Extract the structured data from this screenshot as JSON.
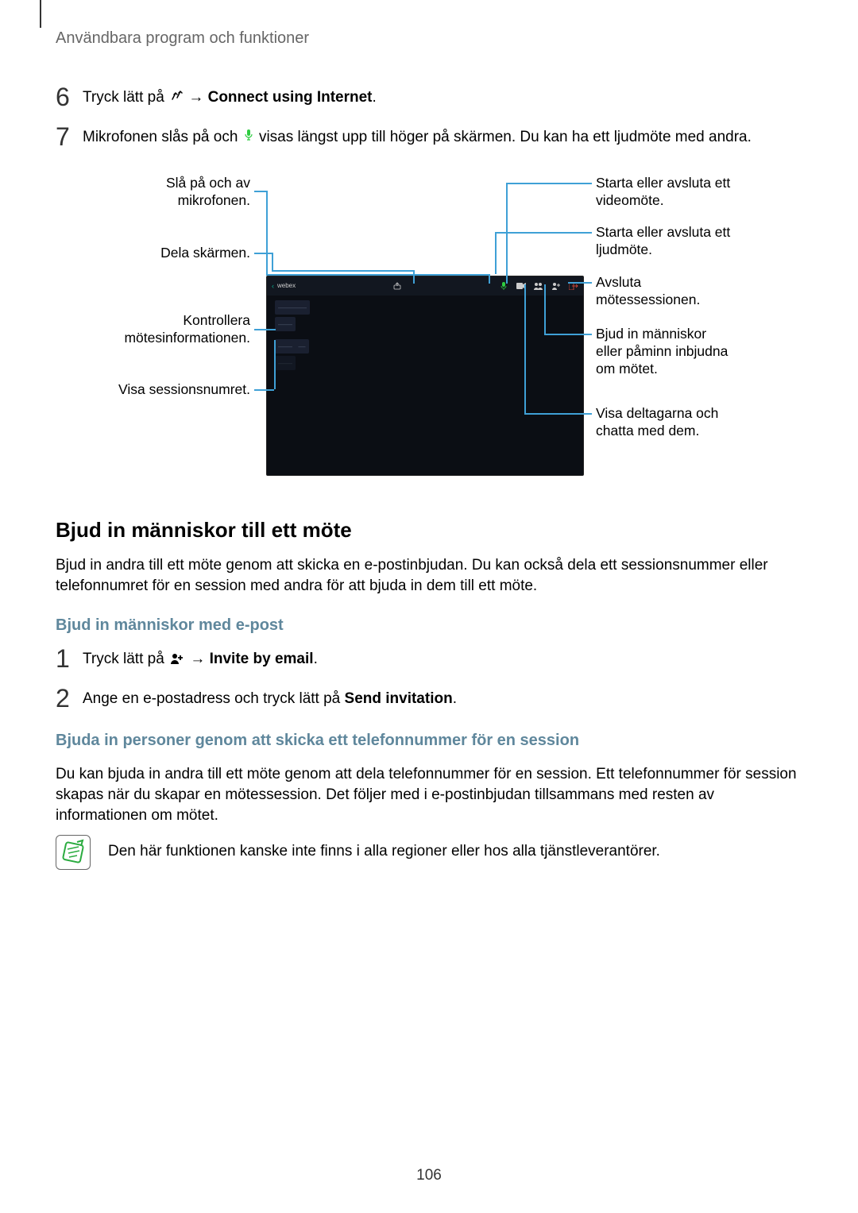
{
  "header": {
    "title": "Användbara program och funktioner"
  },
  "step6": {
    "num": "6",
    "pre": "Tryck lätt på ",
    "arrow": " → ",
    "bold": "Connect using Internet",
    "period": "."
  },
  "step7": {
    "num": "7",
    "pre": "Mikrofonen slås på och ",
    "post": " visas längst upp till höger på skärmen. Du kan ha ett ljudmöte med andra."
  },
  "callouts": {
    "left": [
      "Slå på och av mikrofonen.",
      "Dela skärmen.",
      "Kontrollera mötesinformationen.",
      "Visa sessionsnumret."
    ],
    "right": [
      "Starta eller avsluta ett videomöte.",
      "Starta eller avsluta ett ljudmöte.",
      "Avsluta mötessessionen.",
      "Bjud in människor eller påminn inbjudna om mötet.",
      "Visa deltagarna och chatta med dem."
    ]
  },
  "invite": {
    "heading": "Bjud in människor till ett möte",
    "body": "Bjud in andra till ett möte genom att skicka en e-postinbjudan. Du kan också dela ett sessionsnummer eller telefonnumret för en session med andra för att bjuda in dem till ett möte.",
    "email_heading": "Bjud in människor med e-post",
    "step1": {
      "num": "1",
      "pre": "Tryck lätt på ",
      "arrow": " → ",
      "bold": "Invite by email",
      "period": "."
    },
    "step2": {
      "num": "2",
      "pre": "Ange en e-postadress och tryck lätt på ",
      "bold": "Send invitation",
      "period": "."
    },
    "phone_heading": "Bjuda in personer genom att skicka ett telefonnummer för en session",
    "phone_body": "Du kan bjuda in andra till ett möte genom att dela telefonnummer för en session. Ett telefonnummer för session skapas när du skapar en mötessession. Det följer med i e-postinbjudan tillsammans med resten av informationen om mötet."
  },
  "note": {
    "text": "Den här funktionen kanske inte finns i alla regioner eller hos alla tjänstleverantörer."
  },
  "page_number": "106"
}
